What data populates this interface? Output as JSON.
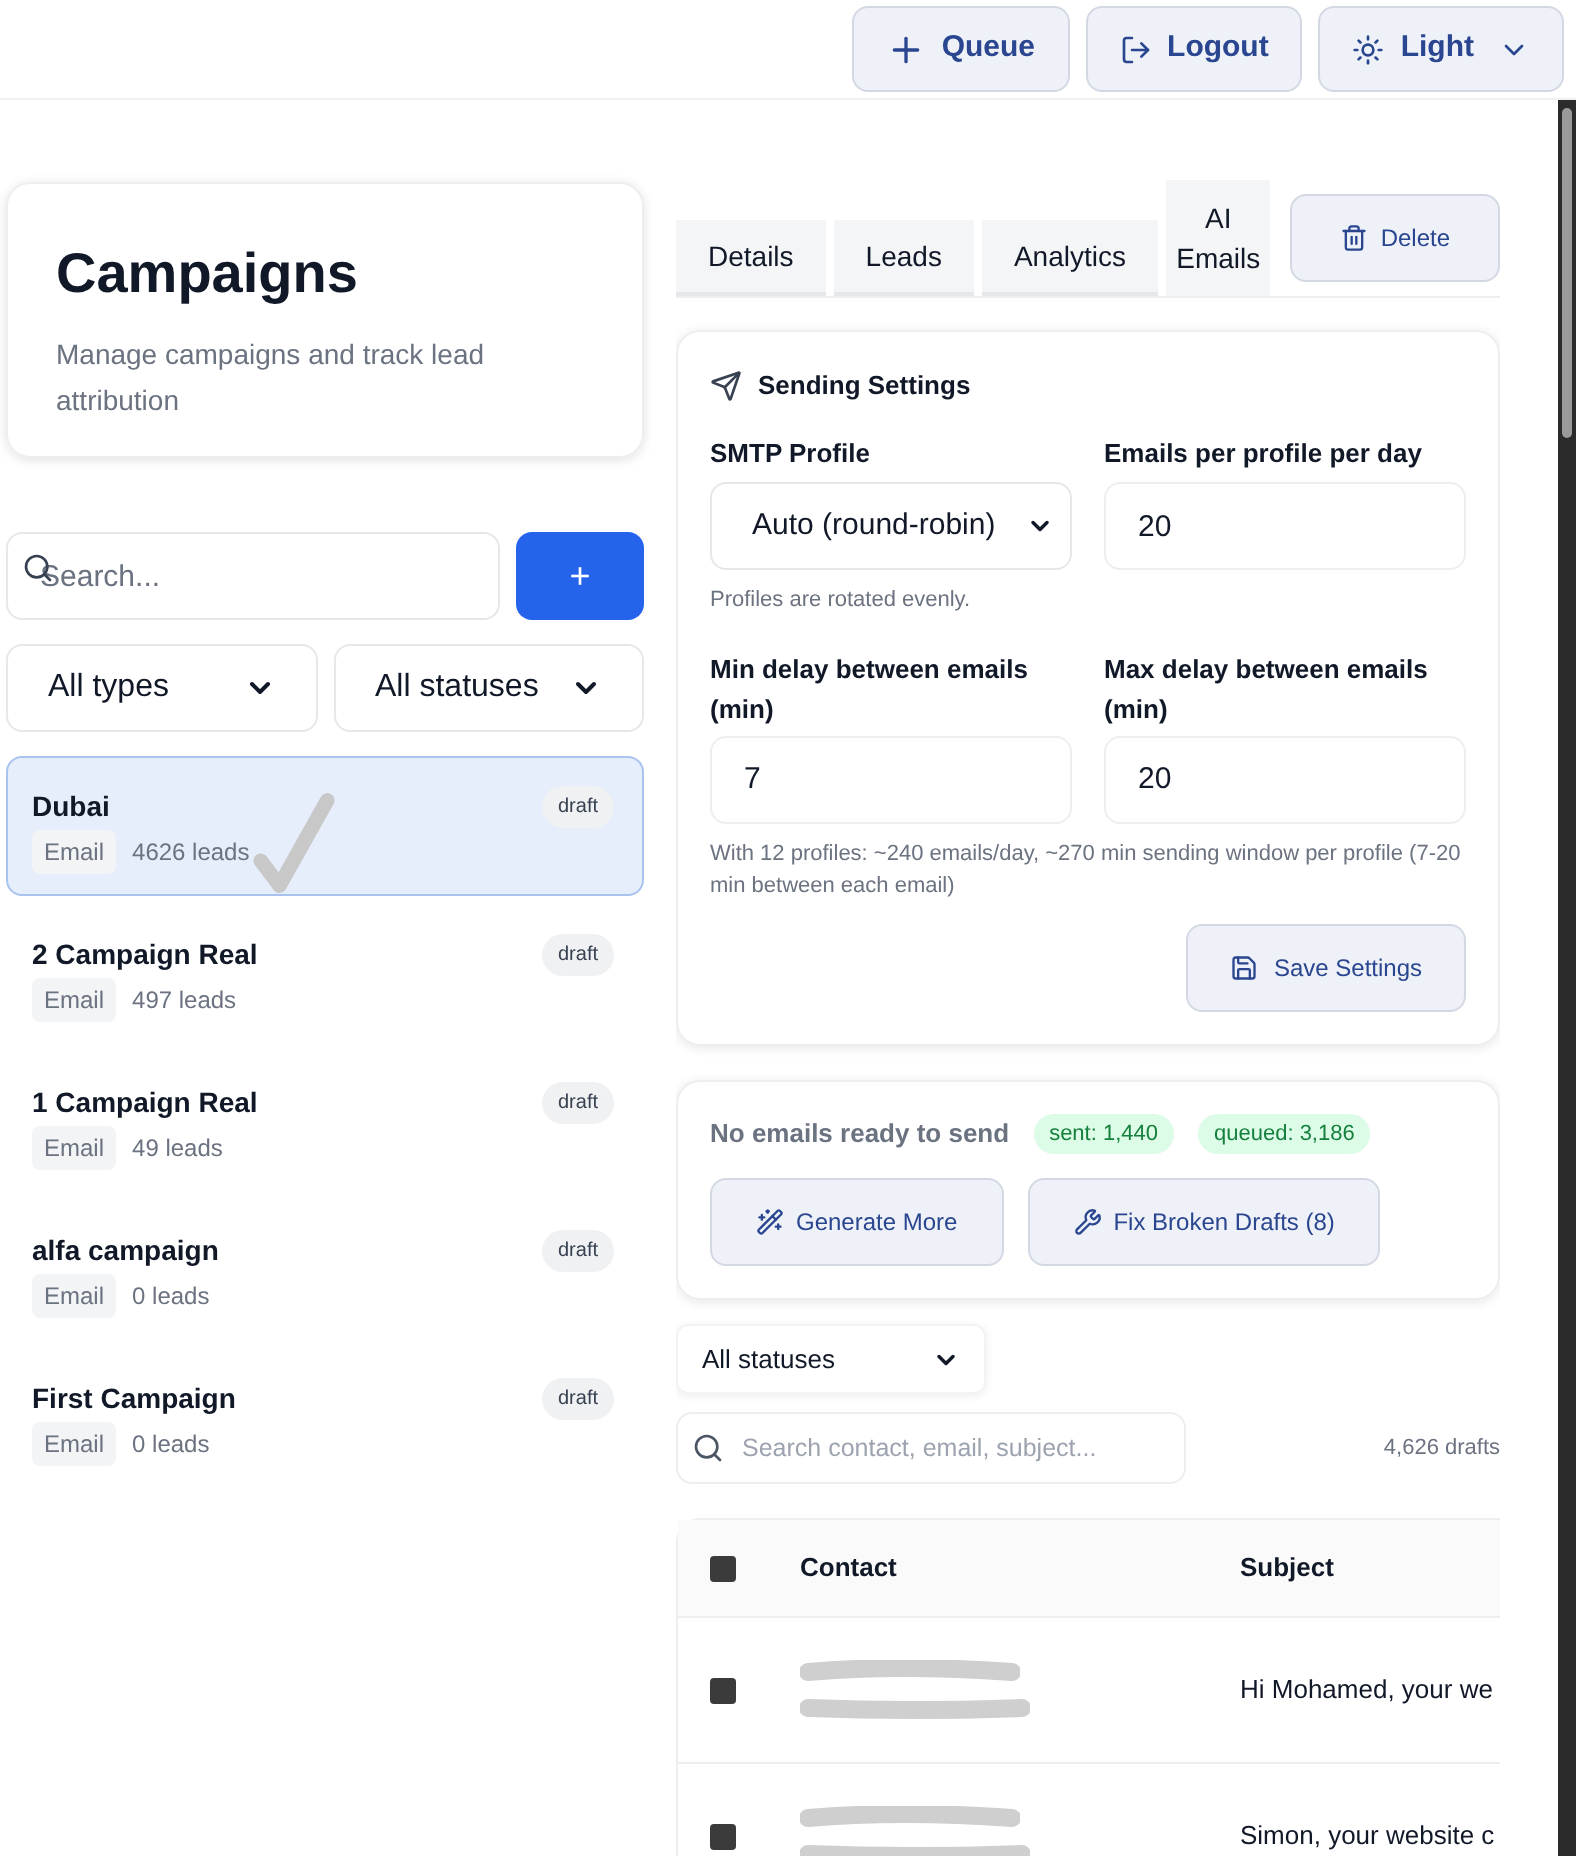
{
  "header": {
    "buttons": [
      {
        "kind": "queue",
        "label": "Queue"
      },
      {
        "kind": "logout",
        "label": "Logout"
      },
      {
        "kind": "theme",
        "label": "Light"
      }
    ]
  },
  "sidebar": {
    "title": "Campaigns",
    "subtitle": "Manage campaigns and track lead attribution",
    "search": {
      "placeholder": "Search..."
    },
    "add_button": "+",
    "filters": [
      "All types",
      "All statuses"
    ],
    "campaigns": [
      {
        "name": "Dubai",
        "type": "Email",
        "leads": "4626 leads",
        "status": "draft",
        "selected": true
      },
      {
        "name": "2 Campaign Real",
        "type": "Email",
        "leads": "497 leads",
        "status": "draft",
        "selected": false
      },
      {
        "name": "1 Campaign Real",
        "type": "Email",
        "leads": "49 leads",
        "status": "draft",
        "selected": false
      },
      {
        "name": "alfa campaign",
        "type": "Email",
        "leads": "0 leads",
        "status": "draft",
        "selected": false
      },
      {
        "name": "First Campaign",
        "type": "Email",
        "leads": "0 leads",
        "status": "draft",
        "selected": false
      }
    ]
  },
  "tabs": [
    {
      "label": "Details",
      "selected": false
    },
    {
      "label": "Leads",
      "selected": false
    },
    {
      "label": "Analytics",
      "selected": false
    },
    {
      "label": "AI Emails",
      "selected": true
    }
  ],
  "delete_button": "Delete",
  "sending_settings": {
    "title": "Sending Settings",
    "smtp_label": "SMTP Profile",
    "smtp_value": "Auto (round-robin)",
    "smtp_hint": "Profiles are rotated evenly.",
    "per_day_label": "Emails per profile per day",
    "per_day_value": "20",
    "min_label": "Min delay between emails (min)",
    "min_value": "7",
    "max_label": "Max delay between emails (min)",
    "max_value": "20",
    "summary": "With 12 profiles: ~240 emails/day, ~270 min sending window per profile (7-20 min between each email)",
    "save_button": "Save Settings"
  },
  "queue_status": {
    "message": "No emails ready to send",
    "badges": [
      "sent: 1,440",
      "queued: 3,186"
    ],
    "buttons": [
      {
        "kind": "generate",
        "label": "Generate More"
      },
      {
        "kind": "fix",
        "label": "Fix Broken Drafts (8)"
      }
    ]
  },
  "drafts": {
    "status_filter": "All statuses",
    "search": {
      "placeholder": "Search contact, email, subject..."
    },
    "count": "4,626 drafts",
    "table": {
      "select_all_checked": false,
      "columns": [
        "Contact",
        "Subject"
      ],
      "rows": [
        {
          "checked": false,
          "subject": "Hi Mohamed, your we"
        },
        {
          "checked": false,
          "subject": "Simon, your website c"
        }
      ]
    }
  }
}
